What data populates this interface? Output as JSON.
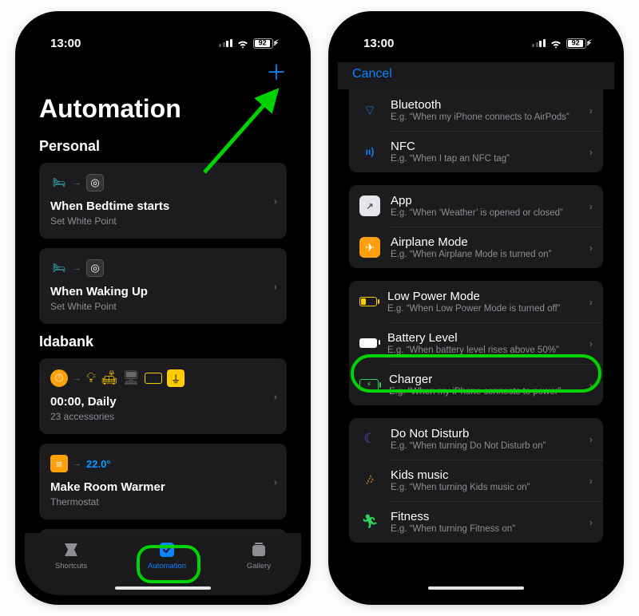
{
  "status": {
    "time": "13:00",
    "battery_pct": "92"
  },
  "phone1": {
    "title": "Automation",
    "sections": {
      "personal": {
        "label": "Personal",
        "items": [
          {
            "title": "When Bedtime starts",
            "subtitle": "Set White Point"
          },
          {
            "title": "When Waking Up",
            "subtitle": "Set White Point"
          }
        ]
      },
      "idabank": {
        "label": "Idabank",
        "items": [
          {
            "title": "00:00, Daily",
            "subtitle": "23 accessories"
          },
          {
            "title": "Make Room Warmer",
            "subtitle": "Thermostat",
            "temp": "22.0°"
          }
        ]
      }
    },
    "tabs": {
      "shortcuts": "Shortcuts",
      "automation": "Automation",
      "gallery": "Gallery"
    }
  },
  "phone2": {
    "cancel": "Cancel",
    "groups": [
      {
        "key": "conn",
        "rows": [
          {
            "icon": "bluetooth",
            "title": "Bluetooth",
            "sub": "E.g. “When my iPhone connects to AirPods”"
          },
          {
            "icon": "nfc",
            "title": "NFC",
            "sub": "E.g. “When I tap an NFC tag”"
          }
        ]
      },
      {
        "key": "app",
        "rows": [
          {
            "icon": "app",
            "title": "App",
            "sub": "E.g. “When ‘Weather’ is opened or closed”"
          },
          {
            "icon": "airplane",
            "title": "Airplane Mode",
            "sub": "E.g. “When Airplane Mode is turned on”"
          }
        ]
      },
      {
        "key": "power",
        "rows": [
          {
            "icon": "lowpower",
            "title": "Low Power Mode",
            "sub": "E.g. “When Low Power Mode is turned off”"
          },
          {
            "icon": "battery",
            "title": "Battery Level",
            "sub": "E.g. “When battery level rises above 50%”"
          },
          {
            "icon": "charger",
            "title": "Charger",
            "sub": "E.g. “When my iPhone connects to power”"
          }
        ]
      },
      {
        "key": "focus",
        "rows": [
          {
            "icon": "dnd",
            "title": "Do Not Disturb",
            "sub": "E.g. “When turning Do Not Disturb on”"
          },
          {
            "icon": "kids",
            "title": "Kids music",
            "sub": "E.g. “When turning Kids music on”"
          },
          {
            "icon": "fitness",
            "title": "Fitness",
            "sub": "E.g. “When turning Fitness on”"
          }
        ]
      }
    ]
  }
}
